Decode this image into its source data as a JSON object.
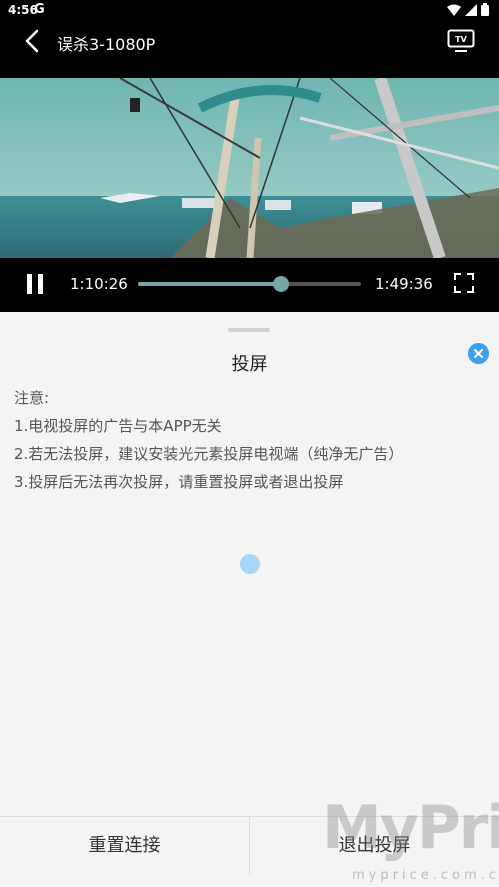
{
  "status_bar": {
    "time": "4:56",
    "app_icon": "G"
  },
  "header": {
    "title": "误杀3-1080P"
  },
  "player": {
    "current_time": "1:10:26",
    "total_time": "1:49:36",
    "progress_fraction": 0.64,
    "accent_color": "#76a8a7"
  },
  "cast_sheet": {
    "title": "投屏",
    "notice_heading": "注意:",
    "notice_lines": [
      "1.电视投屏的广告与本APP无关",
      "2.若无法投屏，建议安装光元素投屏电视端（纯净无广告）",
      "3.投屏后无法再次投屏，请重置投屏或者退出投屏"
    ],
    "reset_label": "重置连接",
    "exit_label": "退出投屏",
    "loading_color": "#a8d6f6"
  },
  "watermark": {
    "brand": "MyPrice",
    "domain": "myprice.com.cn"
  }
}
